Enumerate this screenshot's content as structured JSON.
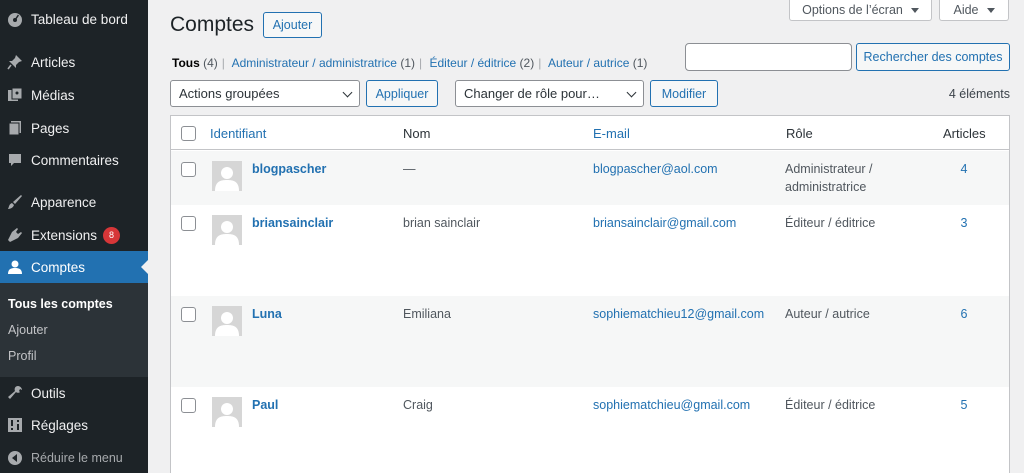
{
  "sidebar": {
    "items": [
      {
        "label": "Tableau de bord",
        "icon": "dashboard-icon"
      },
      {
        "label": "Articles",
        "icon": "pin-icon"
      },
      {
        "label": "Médias",
        "icon": "media-icon"
      },
      {
        "label": "Pages",
        "icon": "page-icon"
      },
      {
        "label": "Commentaires",
        "icon": "comment-icon"
      },
      {
        "label": "Apparence",
        "icon": "brush-icon"
      },
      {
        "label": "Extensions",
        "icon": "plugin-icon",
        "badge": "8"
      },
      {
        "label": "Comptes",
        "icon": "user-icon"
      },
      {
        "label": "Outils",
        "icon": "wrench-icon"
      },
      {
        "label": "Réglages",
        "icon": "settings-icon"
      }
    ],
    "submenu": [
      "Tous les comptes",
      "Ajouter",
      "Profil"
    ],
    "collapse_label": "Réduire le menu"
  },
  "header": {
    "title": "Comptes",
    "add_new": "Ajouter",
    "screen_options": "Options de l’écran",
    "help": "Aide"
  },
  "views": [
    {
      "label": "Tous",
      "count": "(4)"
    },
    {
      "label": "Administrateur / administratrice",
      "count": "(1)"
    },
    {
      "label": "Éditeur / éditrice",
      "count": "(2)"
    },
    {
      "label": "Auteur / autrice",
      "count": "(1)"
    }
  ],
  "search": {
    "value": "",
    "button": "Rechercher des comptes"
  },
  "bulk": {
    "select": "Actions groupées",
    "apply": "Appliquer"
  },
  "role_change": {
    "select": "Changer de rôle pour…",
    "button": "Modifier"
  },
  "item_count": "4 éléments",
  "table": {
    "columns": [
      "Identifiant",
      "Nom",
      "E-mail",
      "Rôle",
      "Articles"
    ],
    "rows": [
      {
        "username": "blogpascher",
        "name": "—",
        "email": "blogpascher@aol.com",
        "role": "Administrateur / administratrice",
        "posts": "4"
      },
      {
        "username": "briansainclair",
        "name": "brian sainclair",
        "email": "briansainclair@gmail.com",
        "role": "Éditeur / éditrice",
        "posts": "3"
      },
      {
        "username": "Luna",
        "name": "Emiliana",
        "email": "sophiematchieu12@gmail.com",
        "role": "Auteur / autrice",
        "posts": "6"
      },
      {
        "username": "Paul",
        "name": "Craig",
        "email": "sophiematchieu@gmail.com",
        "role": "Éditeur / éditrice",
        "posts": "5"
      }
    ]
  },
  "colors": {
    "accent": "#2271b1",
    "sidebar": "#1d2327",
    "badge": "#d63638"
  }
}
